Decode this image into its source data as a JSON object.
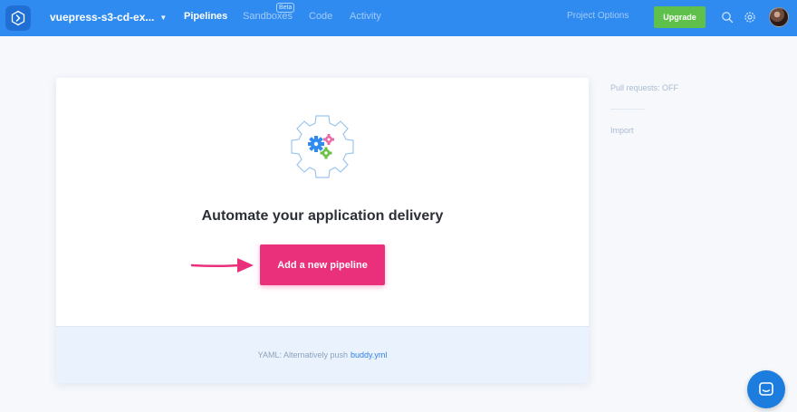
{
  "header": {
    "project_name": "vuepress-s3-cd-ex...",
    "nav": {
      "pipelines": "Pipelines",
      "sandboxes": "Sandboxes",
      "sandboxes_badge": "Beta",
      "code": "Code",
      "activity": "Activity"
    },
    "project_options": "Project Options",
    "upgrade_label": "Upgrade"
  },
  "main": {
    "headline": "Automate your application delivery",
    "add_pipeline_label": "Add a new pipeline",
    "footer_text": "YAML: Alternatively push",
    "footer_link": "buddy.yml"
  },
  "sidebar": {
    "pull_requests": "Pull requests: OFF",
    "import": "Import"
  },
  "colors": {
    "topbar": "#2f8bf0",
    "upgrade": "#5fc14c",
    "accent_pink": "#ea2f7b",
    "gear_blue": "#2f8bf0",
    "gear_pink": "#e96aa8",
    "gear_green": "#6cc04a"
  },
  "icons": {
    "logo": "chevron-right-logo-icon",
    "search": "search-icon",
    "settings": "gear-icon",
    "chat": "chat-icon",
    "arrow": "arrow-right-icon",
    "gears": "gears-illustration-icon"
  }
}
